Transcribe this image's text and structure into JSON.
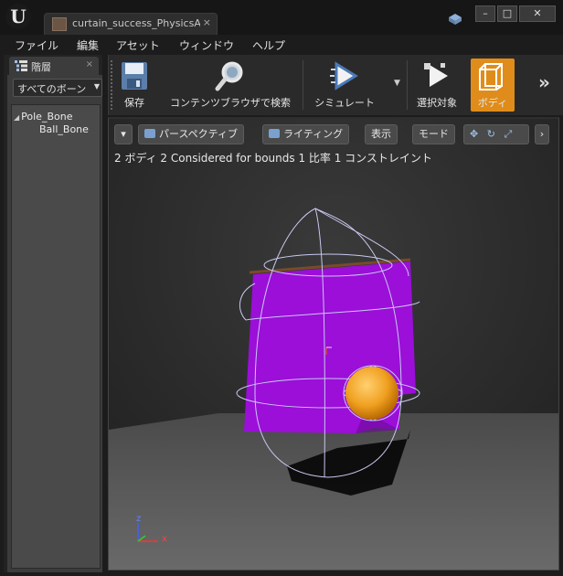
{
  "window": {
    "tab_title": "curtain_success_PhysicsA",
    "tab_close": "×",
    "minimize": "–",
    "maximize": "□",
    "close": "✕"
  },
  "menu": {
    "items": [
      "ファイル",
      "編集",
      "アセット",
      "ウィンドウ",
      "ヘルプ"
    ]
  },
  "hierarchy": {
    "tab_label": "階層",
    "tab_close": "×",
    "filter_value": "すべてのボーン",
    "bones": [
      {
        "name": "Pole_Bone",
        "expanded": true
      },
      {
        "name": "Ball_Bone"
      }
    ]
  },
  "toolbar": {
    "save": "保存",
    "browse": "コンテンツブラウザで検索",
    "simulate": "シミュレート",
    "selection": "選択対象",
    "body": "ボディ",
    "more": "»"
  },
  "viewport": {
    "perspective": "パースペクティブ",
    "lighting": "ライティング",
    "show": "表示",
    "mode": "モード",
    "stats": "2 ボディ 2 Considered for bounds 1 比率 1 コンストレイント",
    "axis_z": "z",
    "axis_x": "x"
  },
  "colors": {
    "accent": "#e08c1a",
    "curtain": "#9b0fd8",
    "ball": "#f0a020",
    "wire": "#c8c8f0"
  }
}
